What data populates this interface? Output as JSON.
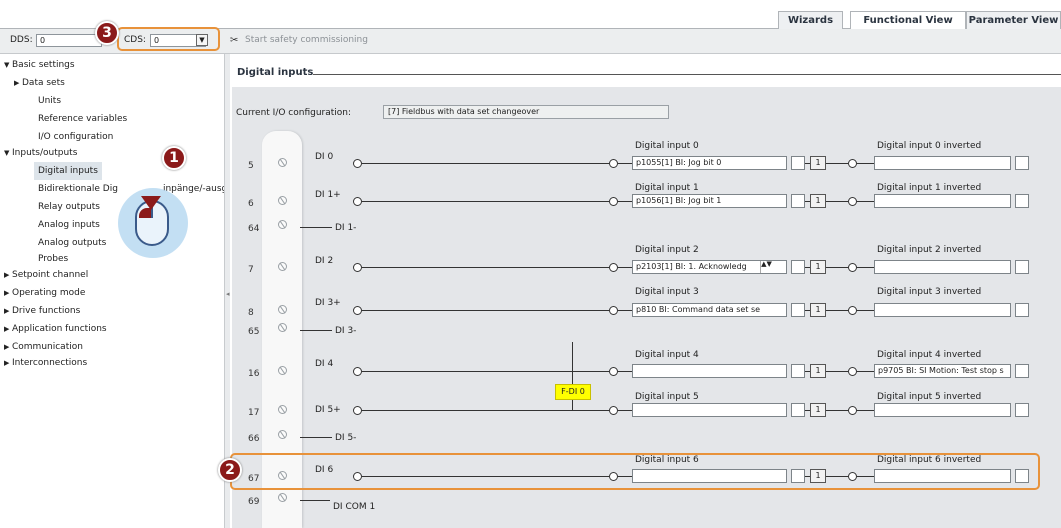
{
  "tabs": [
    "Wizards",
    "Functional View",
    "Parameter View"
  ],
  "toolbar": {
    "dds_label": "DDS:",
    "dds_value": "0",
    "cds_label": "CDS:",
    "cds_value": "0",
    "safety_label": "Start safety commissioning"
  },
  "sidebar": {
    "items": [
      {
        "label": "Basic settings"
      },
      {
        "label": "Data sets"
      },
      {
        "label": "Units"
      },
      {
        "label": "Reference variables"
      },
      {
        "label": "I/O configuration"
      },
      {
        "label": "Inputs/outputs"
      },
      {
        "label": "Digital inputs"
      },
      {
        "label": "Bidirektionale Digitaleingänge/-ausgänge",
        "visible_text_a": "Bidirektionale Dig",
        "visible_text_b": "inpänge/-ausgänge"
      },
      {
        "label": "Relay outputs"
      },
      {
        "label": "Analog inputs"
      },
      {
        "label": "Analog outputs"
      },
      {
        "label": "Probes"
      },
      {
        "label": "Setpoint channel"
      },
      {
        "label": "Operating mode"
      },
      {
        "label": "Drive functions"
      },
      {
        "label": "Application functions"
      },
      {
        "label": "Communication"
      },
      {
        "label": "Interconnections"
      }
    ]
  },
  "main": {
    "section_title": "Digital inputs",
    "io_config_label": "Current I/O configuration:",
    "io_config_value": "[7] Fieldbus with data set changeover",
    "fdi_label": "F-DI 0",
    "com_label": "DI COM 1",
    "inv_symbol": "1",
    "rows": [
      {
        "terminal": "5",
        "di": "DI 0",
        "title": "Digital input 0",
        "value": "p1055[1] BI: Jog bit 0",
        "inv_title": "Digital input 0 inverted",
        "inv_value": ""
      },
      {
        "terminal": "6",
        "di": "DI 1+",
        "title": "Digital input 1",
        "value": "p1056[1] BI: Jog bit 1",
        "inv_title": "Digital input 1 inverted",
        "inv_value": ""
      },
      {
        "terminal": "7",
        "di": "DI 2",
        "title": "Digital input 2",
        "value": "p2103[1] BI: 1. Acknowledg",
        "inv_title": "Digital input 2 inverted",
        "inv_value": ""
      },
      {
        "terminal": "8",
        "di": "DI 3+",
        "title": "Digital input 3",
        "value": "p810 BI: Command data set se",
        "inv_title": "Digital input 3 inverted",
        "inv_value": ""
      },
      {
        "terminal": "16",
        "di": "DI 4",
        "title": "Digital input 4",
        "value": "",
        "inv_title": "Digital input 4 inverted",
        "inv_value": "p9705 BI: SI Motion: Test stop s"
      },
      {
        "terminal": "17",
        "di": "DI 5+",
        "title": "Digital input 5",
        "value": "",
        "inv_title": "Digital input 5 inverted",
        "inv_value": ""
      },
      {
        "terminal": "67",
        "di": "DI 6",
        "title": "Digital input 6",
        "value": "",
        "inv_title": "Digital input 6 inverted",
        "inv_value": ""
      }
    ],
    "minus_rows": [
      {
        "terminal": "64",
        "di": "DI 1-"
      },
      {
        "terminal": "65",
        "di": "DI 3-"
      },
      {
        "terminal": "66",
        "di": "DI 5-"
      },
      {
        "terminal": "69",
        "di": "DI COM 1"
      }
    ]
  },
  "callouts": [
    "1",
    "2",
    "3"
  ],
  "colors": {
    "highlight": "#e8923a",
    "badge": "#8b1a1a",
    "fdi": "#ffff00"
  }
}
